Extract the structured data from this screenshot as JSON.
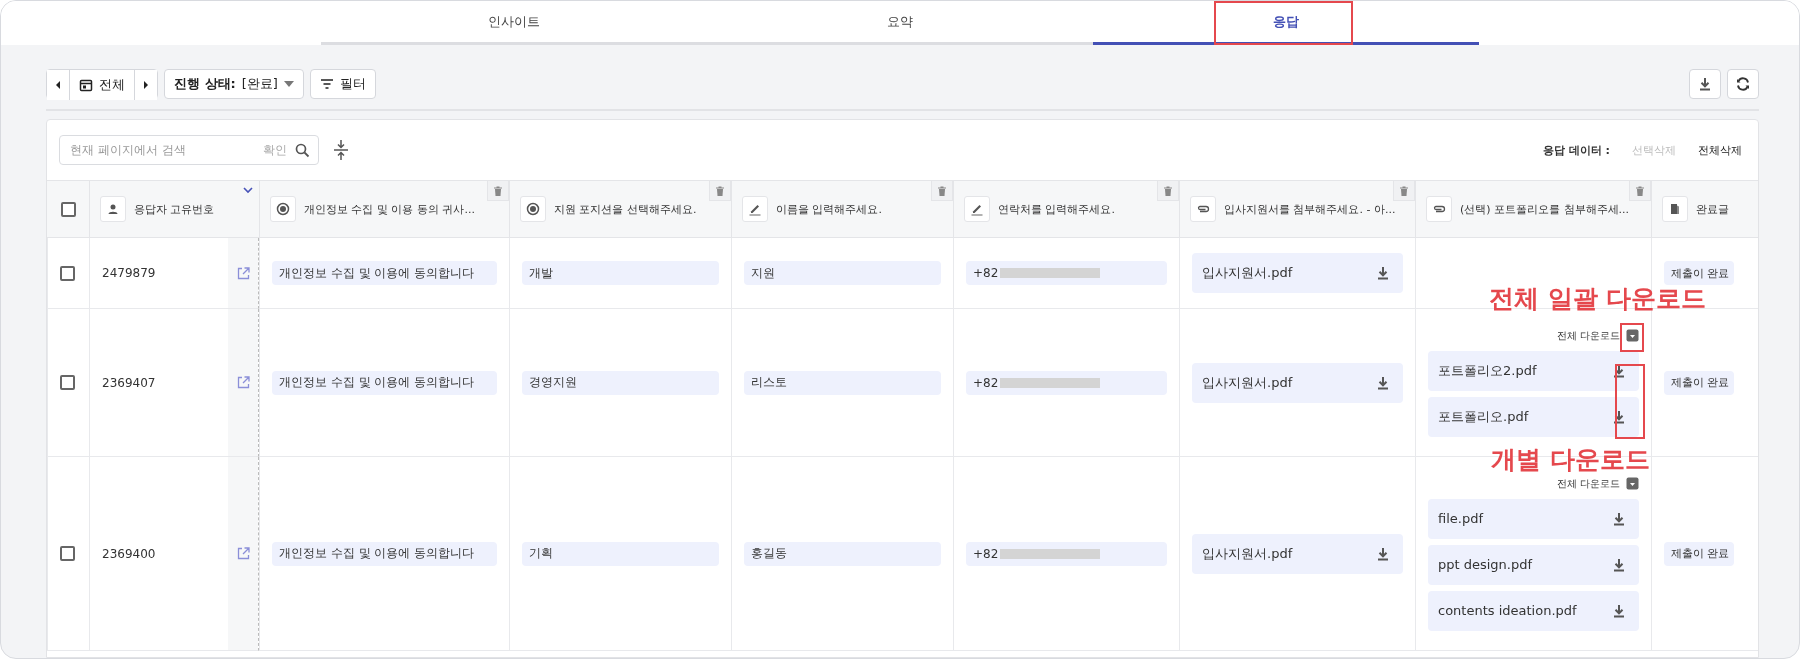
{
  "tabs": [
    {
      "label": "인사이트",
      "selected": false
    },
    {
      "label": "요약",
      "selected": false
    },
    {
      "label": "응답",
      "selected": true
    }
  ],
  "toolbar": {
    "period": "전체",
    "status_label": "진행 상태:",
    "status_value": "[완료]",
    "filter": "필터"
  },
  "search": {
    "placeholder": "현재 페이지에서 검색",
    "confirm": "확인"
  },
  "data_actions": {
    "label": "응답 데이터 :",
    "delete_selected": {
      "label": "선택삭제",
      "disabled": true
    },
    "delete_all": {
      "label": "전체삭제",
      "disabled": false
    }
  },
  "table": {
    "select_all": {
      "checked": false
    },
    "columns": [
      {
        "kind": "respondent",
        "label": "응답자 고유번호"
      },
      {
        "kind": "choice",
        "label": "개인정보 수집 및 이용 동의 귀사..."
      },
      {
        "kind": "choice",
        "label": "지원 포지션을 선택해주세요."
      },
      {
        "kind": "text",
        "label": "이름을 입력해주세요."
      },
      {
        "kind": "phone",
        "label": "연락처를 입력해주세요."
      },
      {
        "kind": "file",
        "label": "입사지원서를 첨부해주세요. - 아..."
      },
      {
        "kind": "file",
        "label": "(선택) 포트폴리오를 첨부해주세..."
      },
      {
        "kind": "completion",
        "label": "완료글"
      }
    ],
    "rows": [
      {
        "checked": false,
        "id": "2479879",
        "consent": "개인정보 수집 및 이용에 동의합니다",
        "position": "개발",
        "name": "지원",
        "phone": "+82",
        "resume": {
          "files": [
            "입사지원서.pdf"
          ]
        },
        "completion": "제출이 완료"
      },
      {
        "checked": false,
        "id": "2369407",
        "consent": "개인정보 수집 및 이용에 동의합니다",
        "position": "경영지원",
        "name": "리스토",
        "phone": "+82",
        "resume": {
          "files": [
            "입사지원서.pdf"
          ]
        },
        "portfolio": {
          "download_all": "전체 다운로드",
          "files": [
            "포트폴리오2.pdf",
            "포트폴리오.pdf"
          ]
        },
        "completion": "제출이 완료"
      },
      {
        "checked": false,
        "id": "2369400",
        "consent": "개인정보 수집 및 이용에 동의합니다",
        "position": "기획",
        "name": "홍길동",
        "phone": "+82",
        "resume": {
          "files": [
            "입사지원서.pdf"
          ]
        },
        "portfolio": {
          "download_all": "전체 다운로드",
          "files": [
            "file.pdf",
            "ppt design.pdf",
            "contents ideation.pdf"
          ]
        },
        "completion": "제출이 완료"
      }
    ]
  },
  "annotations": [
    {
      "text": "전체 일괄 다운로드"
    },
    {
      "text": "개별 다운로드"
    }
  ]
}
